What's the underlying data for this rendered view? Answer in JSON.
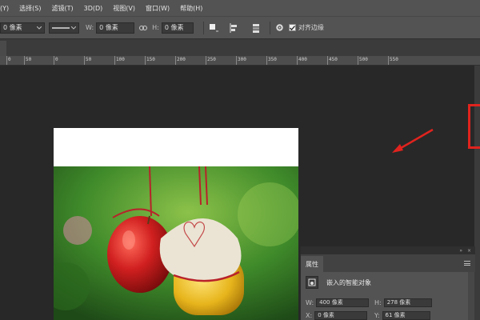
{
  "menu": {
    "items": [
      "(Y)",
      "选择(S)",
      "滤镜(T)",
      "3D(D)",
      "视图(V)",
      "窗口(W)",
      "帮助(H)"
    ]
  },
  "options": {
    "units_value": "0 像素",
    "width_label": "W:",
    "width_value": "0 像素",
    "height_label": "H:",
    "height_value": "0 像素",
    "align_edges_label": "对齐边缘"
  },
  "ruler": {
    "labels": [
      "0",
      "50",
      "0",
      "50",
      "100",
      "150",
      "200",
      "250",
      "300",
      "350",
      "400",
      "450",
      "500",
      "550"
    ]
  },
  "properties": {
    "tab_label": "属性",
    "smart_object_label": "嵌入的智能对象",
    "w_label": "W:",
    "w_value": "400 像素",
    "h_label": "H:",
    "h_value": "278 像素",
    "x_label": "X:",
    "x_value": "0 像素",
    "y_label": "Y:",
    "y_value": "61 像素"
  },
  "colors": {
    "highlight_box": "#e0231e",
    "annotation_arrow": "#e0231e",
    "workspace": "#282828",
    "panel": "#535353"
  }
}
